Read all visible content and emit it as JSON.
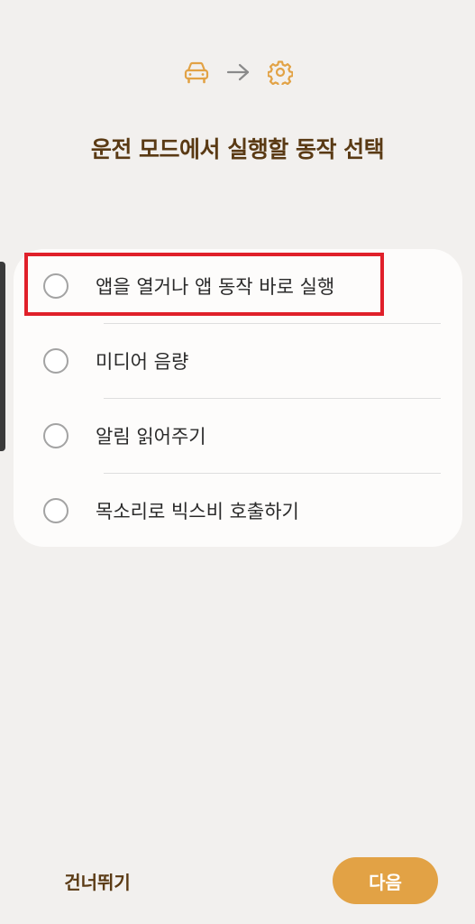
{
  "header": {
    "flow_icons": [
      "car-icon",
      "arrow-right-icon",
      "gear-icon"
    ],
    "title": "운전 모드에서 실행할 동작 선택"
  },
  "options": [
    {
      "label": "앱을 열거나 앱 동작 바로 실행",
      "selected": false
    },
    {
      "label": "미디어 음량",
      "selected": false
    },
    {
      "label": "알림 읽어주기",
      "selected": false
    },
    {
      "label": "목소리로 빅스비 호출하기",
      "selected": false
    }
  ],
  "footer": {
    "skip_label": "건너뛰기",
    "next_label": "다음"
  },
  "colors": {
    "accent": "#e2a245",
    "title": "#5a3a14",
    "highlight": "#e0202a",
    "background": "#f2f0ee"
  }
}
